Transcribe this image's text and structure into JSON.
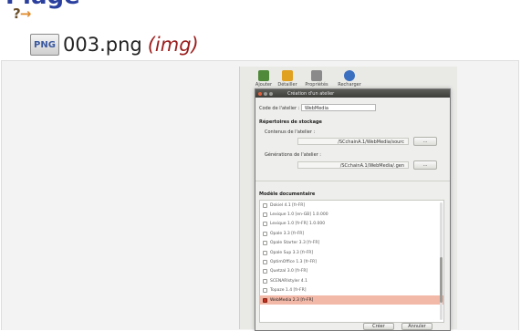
{
  "heading": "Plage",
  "arrow": {
    "question": "?",
    "glyph": "→"
  },
  "file": {
    "icon_text": "PNG",
    "icon": "png-file-icon",
    "name": "003.png",
    "type": "(img)"
  },
  "toolbar": [
    {
      "label": "Ajouter",
      "icon": "add-icon",
      "color": "#4f8a3a"
    },
    {
      "label": "Détailler",
      "icon": "detail-icon",
      "color": "#e0a020"
    },
    {
      "label": "Propriétés",
      "icon": "properties-icon",
      "color": "#8a8a8a"
    },
    {
      "label": "Recharger",
      "icon": "reload-icon",
      "color": "#3b6fc0"
    }
  ],
  "dialog": {
    "title": "Création d'un atelier",
    "code_label": "Code de l'atelier :",
    "code_value": "WebMedia",
    "storage_heading": "Répertoires de stockage",
    "content_label": "Contenus de l'atelier :",
    "content_path": "/SCchainA.1/WebMedia/sourc",
    "generation_label": "Générations de l'atelier :",
    "generation_path": "/SCchainA.1/WebMedia/.gen",
    "browse_label": "...",
    "model_heading": "Modèle documentaire",
    "models": [
      {
        "label": "Dokiel 4.1 [fr-FR]",
        "selected": false
      },
      {
        "label": "Lexique 1.0 [en-GB] 1.0.000",
        "selected": false
      },
      {
        "label": "Lexique 1.0 [fr-FR] 1.0.000",
        "selected": false
      },
      {
        "label": "Opale 3.3 [fr-FR]",
        "selected": false
      },
      {
        "label": "Opale Starter 3.3 [fr-FR]",
        "selected": false
      },
      {
        "label": "Opale Sup 3.3 [fr-FR]",
        "selected": false
      },
      {
        "label": "OptimOffice 1.3 [fr-FR]",
        "selected": false
      },
      {
        "label": "Quetzal 3.0 [fr-FR]",
        "selected": false
      },
      {
        "label": "SCENARIstyler 4.1",
        "selected": false
      },
      {
        "label": "Topaze 1.4 [fr-FR]",
        "selected": false
      },
      {
        "label": "WebMedia 2.3 [fr-FR]",
        "selected": true
      }
    ],
    "create_label": "Créer",
    "cancel_label": "Annuler"
  },
  "colors": {
    "heading": "#2a3f9e",
    "type": "#9b1d1d",
    "selected_row": "#f2b8a8",
    "arrow": "#e08a2c"
  }
}
